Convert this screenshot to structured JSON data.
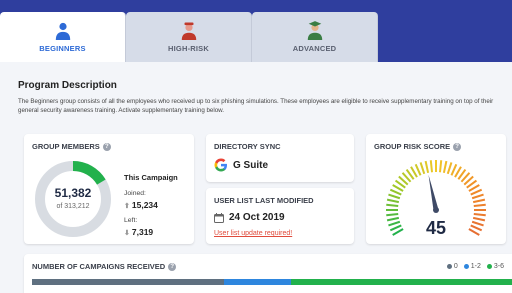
{
  "tabs": [
    {
      "label": "BEGINNERS",
      "icon": "beginner-person-icon",
      "active": true
    },
    {
      "label": "HIGH-RISK",
      "icon": "high-risk-person-icon",
      "active": false
    },
    {
      "label": "ADVANCED",
      "icon": "advanced-person-icon",
      "active": false
    }
  ],
  "program": {
    "title": "Program Description",
    "description": "The Beginners group consists of all the employees who received up to six phishing simulations. These employees are eligible to receive supplementary training on top of their general security awareness training. Activate supplementary training below."
  },
  "members": {
    "title": "GROUP MEMBERS",
    "count": "51,382",
    "of_total": "of 313,212",
    "fraction": 0.164,
    "campaign_label": "This Campaign",
    "joined_label": "Joined:",
    "joined_value": "15,234",
    "left_label": "Left:",
    "left_value": "7,319"
  },
  "directory": {
    "title": "DIRECTORY SYNC",
    "value": "G Suite",
    "icon": "google-g-icon"
  },
  "user_list": {
    "title": "USER LIST LAST MODIFIED",
    "date": "24 Oct 2019",
    "link": "User list update required!",
    "icon": "calendar-icon"
  },
  "risk": {
    "title": "GROUP RISK SCORE",
    "value": "45",
    "score": 45,
    "max": 100
  },
  "campaigns": {
    "title": "NUMBER OF CAMPAIGNS RECEIVED",
    "legend": [
      {
        "label": "0",
        "color": "#5f7080"
      },
      {
        "label": "1-2",
        "color": "#2e86de"
      },
      {
        "label": "3-6",
        "color": "#22b14c"
      }
    ],
    "segments": [
      40,
      14,
      46
    ]
  },
  "colors": {
    "accent_blue": "#2d6ad6",
    "header_bg": "#2f3e9e",
    "donut_green": "#22b14c",
    "donut_gray": "#d8dce2",
    "link_red": "#e04b3c"
  }
}
